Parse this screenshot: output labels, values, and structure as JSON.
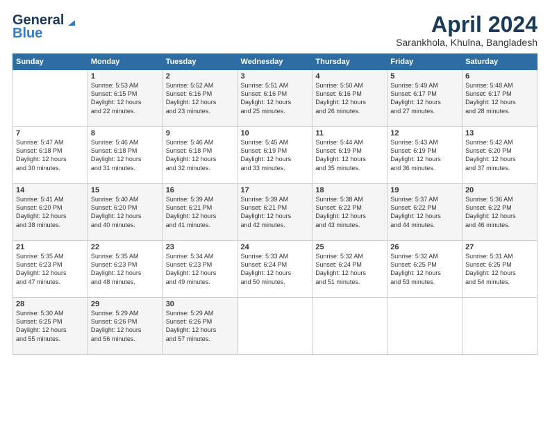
{
  "header": {
    "logo_line1": "General",
    "logo_line2": "Blue",
    "month": "April 2024",
    "location": "Sarankhola, Khulna, Bangladesh"
  },
  "columns": [
    "Sunday",
    "Monday",
    "Tuesday",
    "Wednesday",
    "Thursday",
    "Friday",
    "Saturday"
  ],
  "weeks": [
    [
      {
        "day": "",
        "content": ""
      },
      {
        "day": "1",
        "content": "Sunrise: 5:53 AM\nSunset: 6:15 PM\nDaylight: 12 hours\nand 22 minutes."
      },
      {
        "day": "2",
        "content": "Sunrise: 5:52 AM\nSunset: 6:16 PM\nDaylight: 12 hours\nand 23 minutes."
      },
      {
        "day": "3",
        "content": "Sunrise: 5:51 AM\nSunset: 6:16 PM\nDaylight: 12 hours\nand 25 minutes."
      },
      {
        "day": "4",
        "content": "Sunrise: 5:50 AM\nSunset: 6:16 PM\nDaylight: 12 hours\nand 26 minutes."
      },
      {
        "day": "5",
        "content": "Sunrise: 5:49 AM\nSunset: 6:17 PM\nDaylight: 12 hours\nand 27 minutes."
      },
      {
        "day": "6",
        "content": "Sunrise: 5:48 AM\nSunset: 6:17 PM\nDaylight: 12 hours\nand 28 minutes."
      }
    ],
    [
      {
        "day": "7",
        "content": "Sunrise: 5:47 AM\nSunset: 6:18 PM\nDaylight: 12 hours\nand 30 minutes."
      },
      {
        "day": "8",
        "content": "Sunrise: 5:46 AM\nSunset: 6:18 PM\nDaylight: 12 hours\nand 31 minutes."
      },
      {
        "day": "9",
        "content": "Sunrise: 5:46 AM\nSunset: 6:18 PM\nDaylight: 12 hours\nand 32 minutes."
      },
      {
        "day": "10",
        "content": "Sunrise: 5:45 AM\nSunset: 6:19 PM\nDaylight: 12 hours\nand 33 minutes."
      },
      {
        "day": "11",
        "content": "Sunrise: 5:44 AM\nSunset: 6:19 PM\nDaylight: 12 hours\nand 35 minutes."
      },
      {
        "day": "12",
        "content": "Sunrise: 5:43 AM\nSunset: 6:19 PM\nDaylight: 12 hours\nand 36 minutes."
      },
      {
        "day": "13",
        "content": "Sunrise: 5:42 AM\nSunset: 6:20 PM\nDaylight: 12 hours\nand 37 minutes."
      }
    ],
    [
      {
        "day": "14",
        "content": "Sunrise: 5:41 AM\nSunset: 6:20 PM\nDaylight: 12 hours\nand 38 minutes."
      },
      {
        "day": "15",
        "content": "Sunrise: 5:40 AM\nSunset: 6:20 PM\nDaylight: 12 hours\nand 40 minutes."
      },
      {
        "day": "16",
        "content": "Sunrise: 5:39 AM\nSunset: 6:21 PM\nDaylight: 12 hours\nand 41 minutes."
      },
      {
        "day": "17",
        "content": "Sunrise: 5:39 AM\nSunset: 6:21 PM\nDaylight: 12 hours\nand 42 minutes."
      },
      {
        "day": "18",
        "content": "Sunrise: 5:38 AM\nSunset: 6:22 PM\nDaylight: 12 hours\nand 43 minutes."
      },
      {
        "day": "19",
        "content": "Sunrise: 5:37 AM\nSunset: 6:22 PM\nDaylight: 12 hours\nand 44 minutes."
      },
      {
        "day": "20",
        "content": "Sunrise: 5:36 AM\nSunset: 6:22 PM\nDaylight: 12 hours\nand 46 minutes."
      }
    ],
    [
      {
        "day": "21",
        "content": "Sunrise: 5:35 AM\nSunset: 6:23 PM\nDaylight: 12 hours\nand 47 minutes."
      },
      {
        "day": "22",
        "content": "Sunrise: 5:35 AM\nSunset: 6:23 PM\nDaylight: 12 hours\nand 48 minutes."
      },
      {
        "day": "23",
        "content": "Sunrise: 5:34 AM\nSunset: 6:23 PM\nDaylight: 12 hours\nand 49 minutes."
      },
      {
        "day": "24",
        "content": "Sunrise: 5:33 AM\nSunset: 6:24 PM\nDaylight: 12 hours\nand 50 minutes."
      },
      {
        "day": "25",
        "content": "Sunrise: 5:32 AM\nSunset: 6:24 PM\nDaylight: 12 hours\nand 51 minutes."
      },
      {
        "day": "26",
        "content": "Sunrise: 5:32 AM\nSunset: 6:25 PM\nDaylight: 12 hours\nand 53 minutes."
      },
      {
        "day": "27",
        "content": "Sunrise: 5:31 AM\nSunset: 6:25 PM\nDaylight: 12 hours\nand 54 minutes."
      }
    ],
    [
      {
        "day": "28",
        "content": "Sunrise: 5:30 AM\nSunset: 6:25 PM\nDaylight: 12 hours\nand 55 minutes."
      },
      {
        "day": "29",
        "content": "Sunrise: 5:29 AM\nSunset: 6:26 PM\nDaylight: 12 hours\nand 56 minutes."
      },
      {
        "day": "30",
        "content": "Sunrise: 5:29 AM\nSunset: 6:26 PM\nDaylight: 12 hours\nand 57 minutes."
      },
      {
        "day": "",
        "content": ""
      },
      {
        "day": "",
        "content": ""
      },
      {
        "day": "",
        "content": ""
      },
      {
        "day": "",
        "content": ""
      }
    ]
  ]
}
